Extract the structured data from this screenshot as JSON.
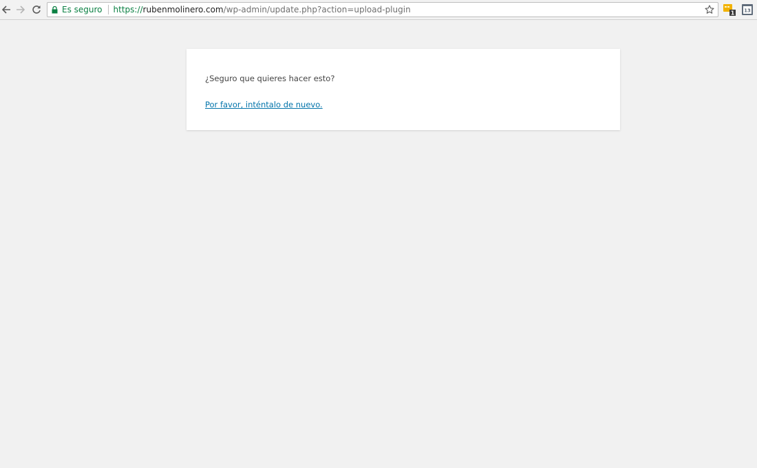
{
  "browser": {
    "security_label": "Es seguro",
    "url": {
      "scheme": "https://",
      "host": "rubenmolinero.com",
      "path": "/wp-admin/update.php?action=upload-plugin"
    },
    "extensions": [
      {
        "icon": "note-extension-icon",
        "badge": "1"
      },
      {
        "icon": "calendar-extension-icon",
        "badge": "13"
      }
    ]
  },
  "page": {
    "message": "¿Seguro que quieres hacer esto?",
    "retry_link": "Por favor, inténtalo de nuevo."
  },
  "colors": {
    "secure_green": "#0b8043",
    "link_blue": "#0073aa",
    "page_background": "#f1f1f1",
    "card_background": "#ffffff"
  }
}
